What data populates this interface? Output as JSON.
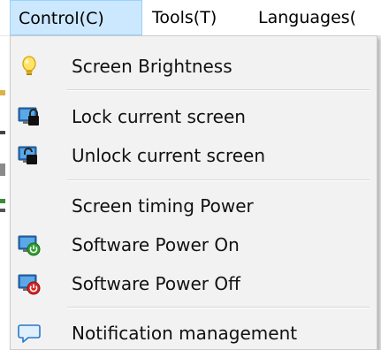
{
  "menubar": {
    "control": "Control(C)",
    "tools": "Tools(T)",
    "languages": "Languages("
  },
  "menu": {
    "items": [
      {
        "label": "Screen Brightness",
        "icon": "lightbulb-icon"
      },
      {
        "label": "Lock current screen",
        "icon": "lock-screen-icon"
      },
      {
        "label": "Unlock current screen",
        "icon": "unlock-screen-icon"
      },
      {
        "label": "Screen timing Power",
        "icon": ""
      },
      {
        "label": "Software Power On",
        "icon": "power-on-icon"
      },
      {
        "label": "Software Power Off",
        "icon": "power-off-icon"
      },
      {
        "label": "Notification management",
        "icon": "speech-bubble-icon"
      }
    ]
  },
  "colors": {
    "active_menu_bg": "#cce8ff",
    "active_menu_border": "#99d1ff",
    "dropdown_bg": "#f2f2f2",
    "separator": "#d7d7d7"
  }
}
